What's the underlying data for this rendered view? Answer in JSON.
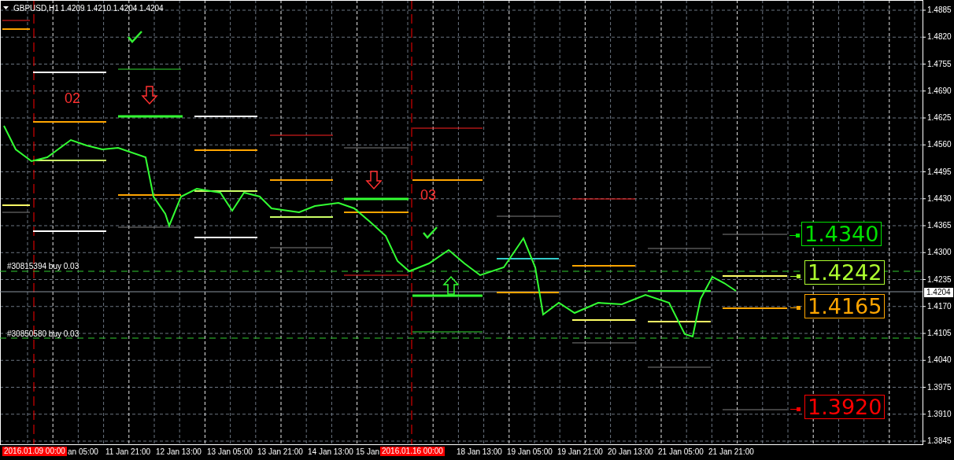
{
  "chart_header": {
    "symbol": "GBPUSD,H1",
    "quotes": "1.4209 1.4210 1.4204 1.4204"
  },
  "price_axis": {
    "ticks": [
      "1.4885",
      "1.4820",
      "1.4755",
      "1.4690",
      "1.4625",
      "1.4560",
      "1.4495",
      "1.4430",
      "1.4365",
      "1.4300",
      "1.4235",
      "1.4170",
      "1.4105",
      "1.4040",
      "1.3975",
      "1.3910",
      "1.3845"
    ],
    "current_price": "1.4204"
  },
  "time_axis": {
    "labels": [
      "an 05:00",
      "11 Jan 21:00",
      "12 Jan 13:00",
      "13 Jan 05:00",
      "13 Jan 21:00",
      "14 Jan 13:00",
      "15 Jan",
      "18 Jan 13:00",
      "19 Jan 05:00",
      "19 Jan 21:00",
      "20 Jan 13:00",
      "21 Jan 05:00",
      "21 Jan 21:00"
    ],
    "separators": [
      "2016.01.09 00:00",
      "2016.01.16 00:00"
    ]
  },
  "wave_labels": [
    "02",
    "03"
  ],
  "orders": [
    "#30815394 buy 0.03",
    "#30850580 buy 0.03"
  ],
  "price_boxes": [
    {
      "text": "1.4340",
      "color": "#00e000"
    },
    {
      "text": "1.4242",
      "color": "#adff2f"
    },
    {
      "text": "1.4165",
      "color": "#ffa500"
    },
    {
      "text": "1.3920",
      "color": "#ff0000"
    }
  ]
}
